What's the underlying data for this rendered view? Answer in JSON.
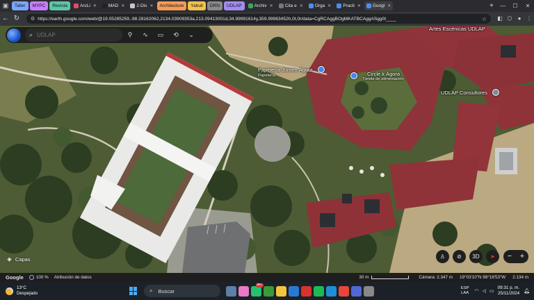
{
  "browser": {
    "tabs": [
      {
        "label": "Taller",
        "style": "pill",
        "color": "#7aa6ff"
      },
      {
        "label": "MYPC",
        "style": "pill",
        "color": "#c77dff"
      },
      {
        "label": "Revista",
        "style": "pill",
        "color": "#5cc6a8"
      },
      {
        "label": "ArcLi",
        "style": "tab",
        "color": "#e34b6b"
      },
      {
        "label": "MAD",
        "style": "tab",
        "color": "#222222"
      },
      {
        "label": "2-Dis",
        "style": "tab",
        "color": "#c8c8c8"
      },
      {
        "label": "Architecture",
        "style": "pill",
        "color": "#f59b54"
      },
      {
        "label": "Yabuli",
        "style": "pill",
        "color": "#f2c14e"
      },
      {
        "label": "DRN",
        "style": "pill",
        "color": "#8a8a8a"
      },
      {
        "label": "UDLAP",
        "style": "pill",
        "color": "#a28cf0"
      },
      {
        "label": "Archiv",
        "style": "tab",
        "color": "#3ba55c"
      },
      {
        "label": "Cita e",
        "style": "tab",
        "color": "#777777"
      },
      {
        "label": "Orga",
        "style": "tab",
        "color": "#4a8ef0"
      },
      {
        "label": "Practi",
        "style": "tab",
        "color": "#4a8ef0"
      },
      {
        "label": "Googl",
        "style": "tab",
        "color": "#4a8ef0",
        "active": true
      }
    ],
    "url": "https://earth.google.com/web/@19.05285259,-98.28162062,2134.03909353a,213.09413001d,34.99991614y,359.99963452h,0t,0r/data=CgRCAggBOgMKATBCAggASgg0I____"
  },
  "search": {
    "placeholder": "UDLAP"
  },
  "map": {
    "labels": {
      "artes": "Artes Escénicas UDLAP",
      "papeleria": "Papelería Jumen Ágora",
      "papeleria_sub": "Papelería",
      "circle": "Circle k Ágora",
      "circle_sub": "Tienda de alimentación",
      "consultores": "UDLAP Consultores"
    },
    "poi_colors": {
      "shop": "#4285f4",
      "store": "#4285f4",
      "office": "#7b8a9b"
    },
    "layers_label": "Capas",
    "compass_3d": "3D"
  },
  "statusbar": {
    "brand": "Google",
    "percent": "100 %",
    "credits": "Atribución de datos",
    "scale": "30 m",
    "camera": "Cámara: 2.347 m",
    "coords": "19°03'10\"N 98°16'53\"W",
    "elevation": "2.134 m"
  },
  "taskbar": {
    "temp": "13°C",
    "weather": "Despejado",
    "search": "Buscar",
    "badge": "99+",
    "lang_top": "ESP",
    "lang_bottom": "LAA",
    "time": "09:31 p. m.",
    "date": "25/11/2024"
  },
  "icons": [
    "globe-icon",
    "search-icon",
    "pin-icon",
    "path-icon",
    "ruler-icon",
    "history-icon",
    "chevron-down-icon",
    "layers-icon",
    "street-view-icon",
    "tilt-icon",
    "compass-icon",
    "zoom-out-icon",
    "zoom-in-icon",
    "windows-icon",
    "wifi-icon",
    "volume-icon",
    "battery-icon",
    "bell-icon"
  ]
}
